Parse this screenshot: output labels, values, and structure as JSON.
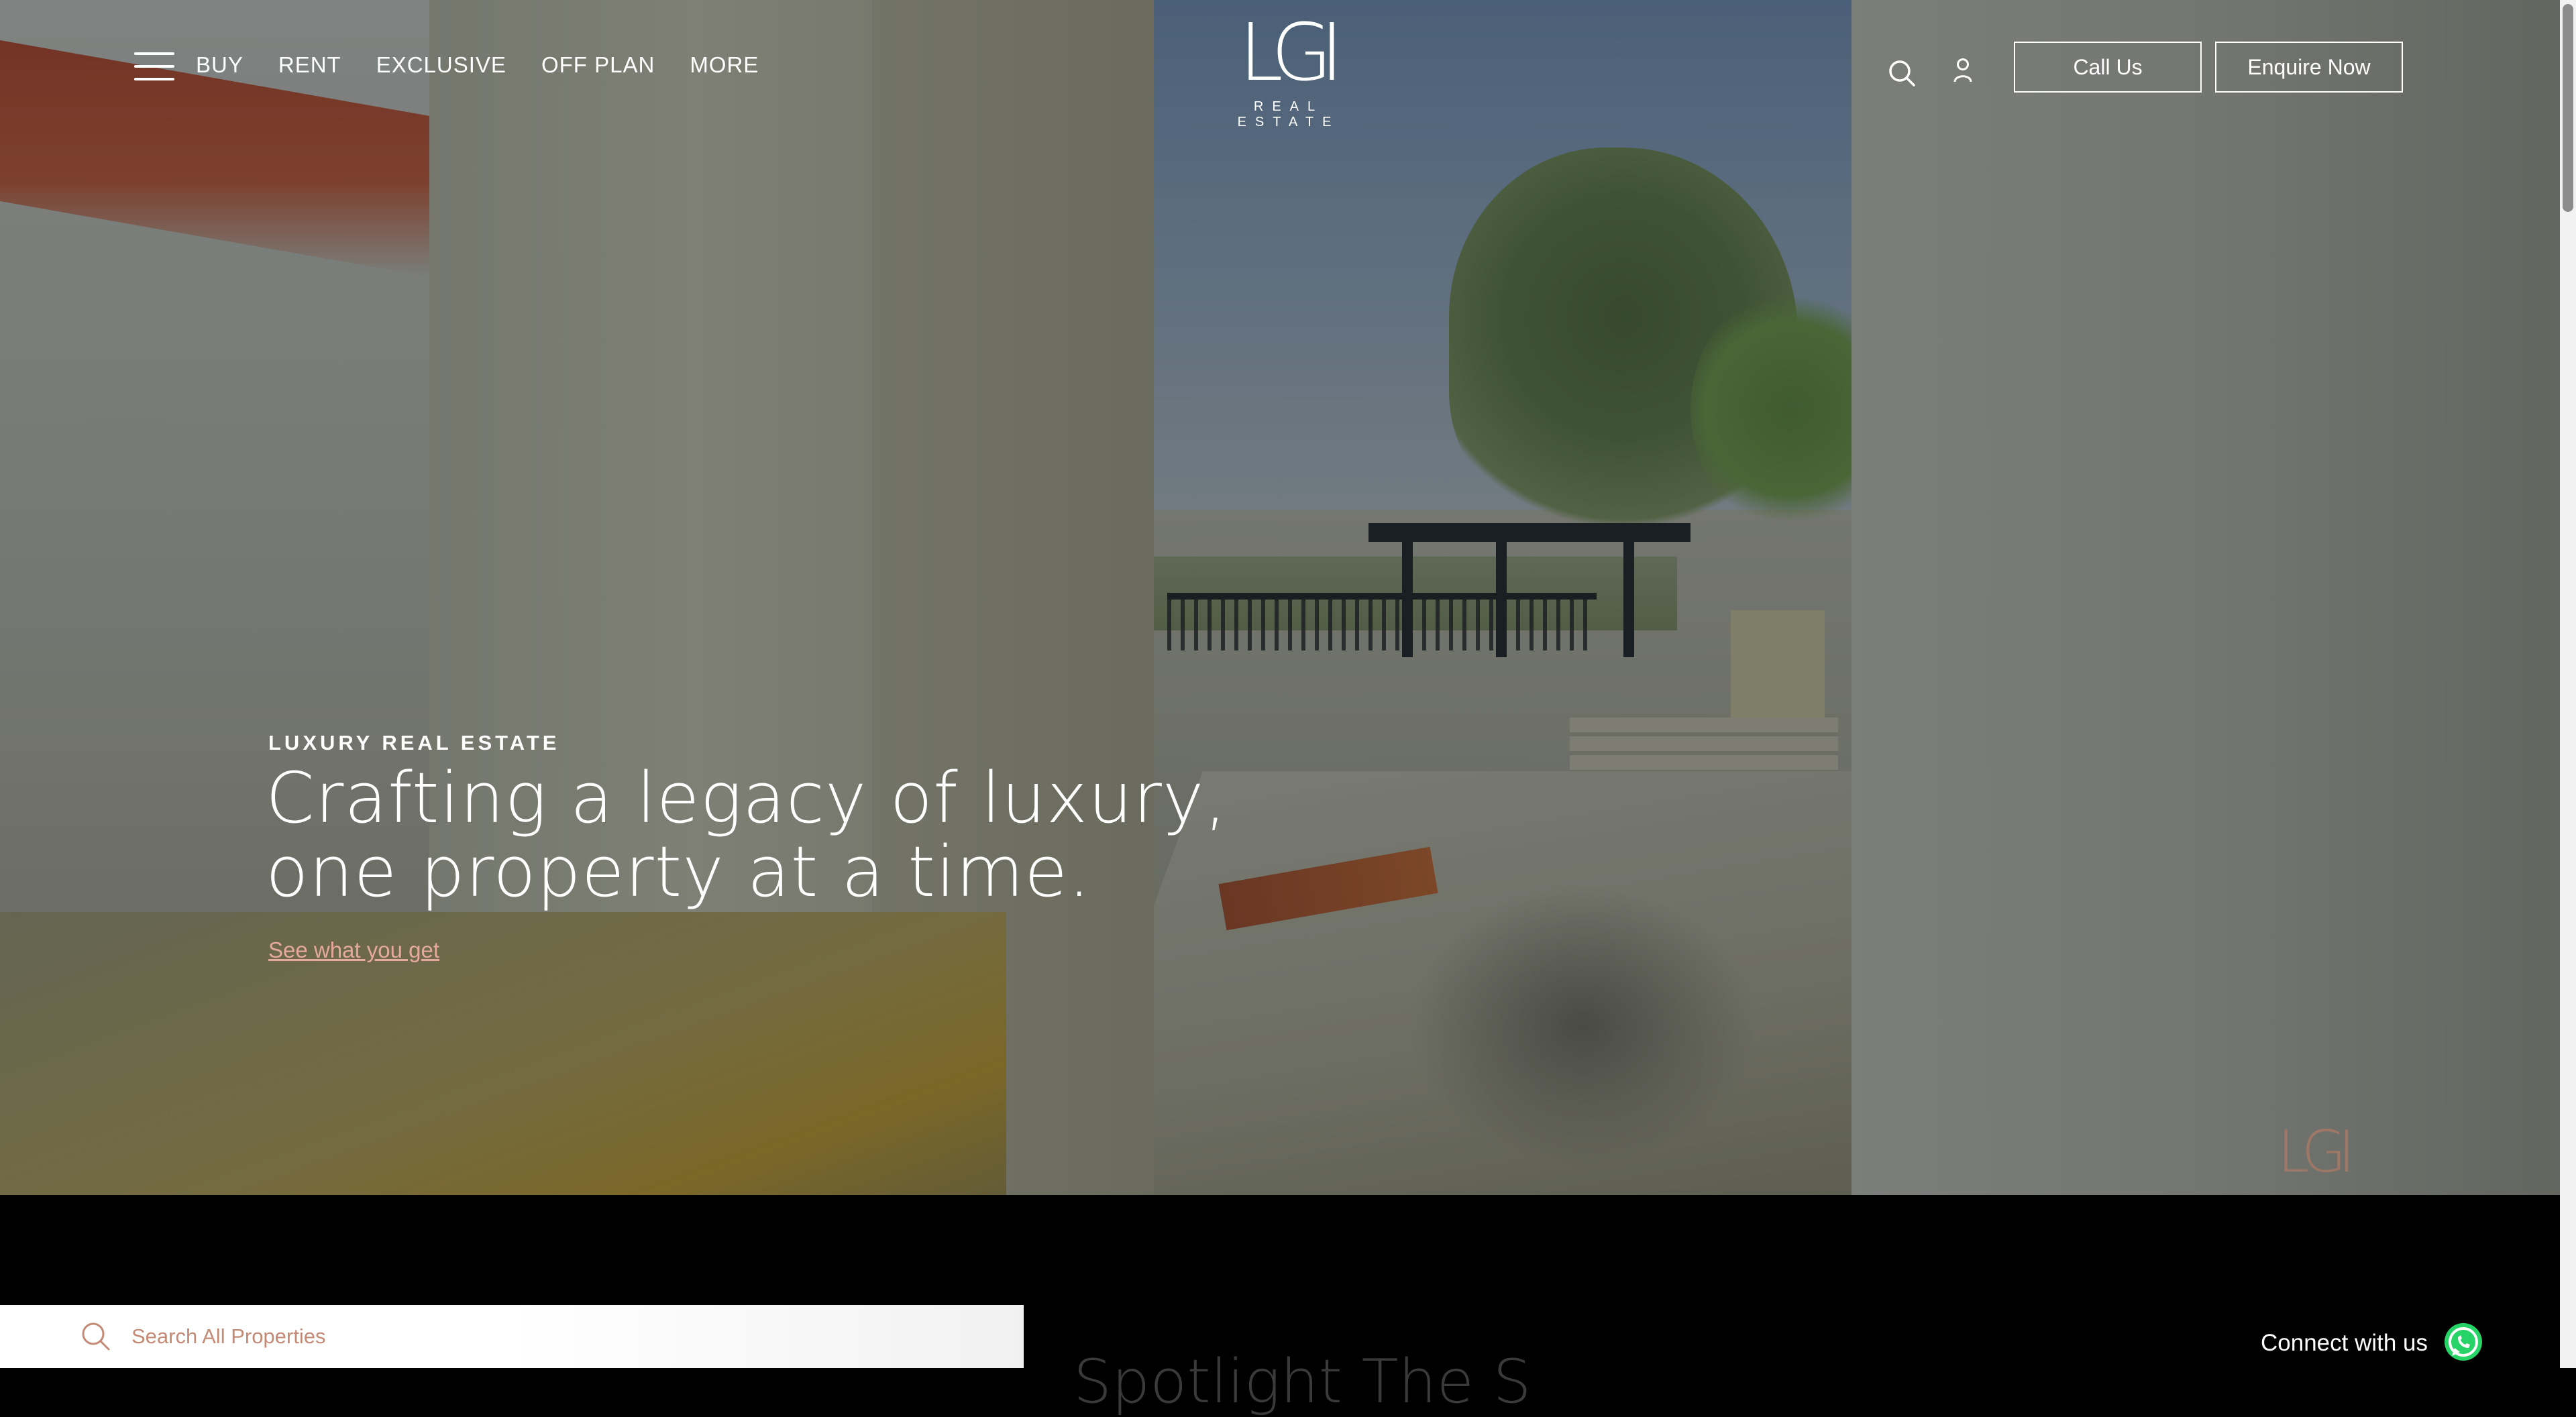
{
  "nav": {
    "menu_icon": "hamburger-menu-icon",
    "items": [
      {
        "label": "BUY"
      },
      {
        "label": "RENT"
      },
      {
        "label": "EXCLUSIVE"
      },
      {
        "label": "OFF PLAN"
      },
      {
        "label": "MORE"
      }
    ]
  },
  "logo": {
    "mark": "LGI",
    "subtitle": "REAL ESTATE"
  },
  "header_actions": {
    "search_icon": "search-icon",
    "account_icon": "user-icon",
    "call_label": "Call Us",
    "enquire_label": "Enquire Now"
  },
  "hero": {
    "eyebrow": "LUXURY REAL ESTATE",
    "headline_line1": "Crafting a legacy of luxury,",
    "headline_line2": "one property at a time.",
    "cta_link": "See what you get"
  },
  "search": {
    "placeholder": "Search All Properties",
    "icon": "search-icon"
  },
  "section": {
    "title_partial": "Spotlight The S"
  },
  "connect": {
    "label": "Connect with us",
    "icon": "whatsapp-icon"
  },
  "colors": {
    "accent": "#e4a99a",
    "search_text": "#c58a76",
    "whatsapp": "#25d366"
  }
}
